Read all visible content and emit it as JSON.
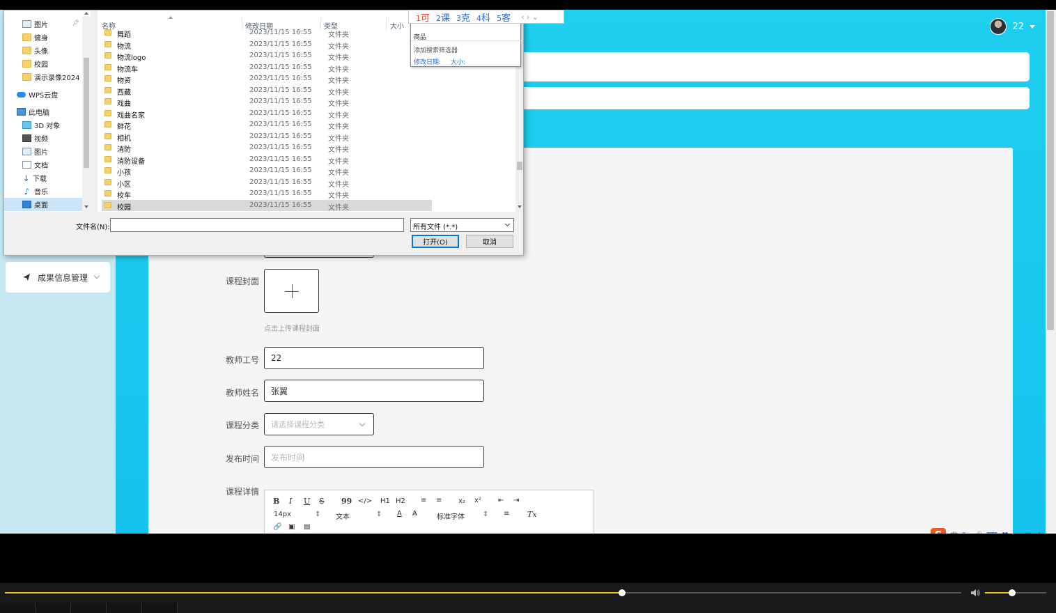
{
  "app": {
    "user_name": "22",
    "menu_item": "成果信息管理",
    "colors": {
      "primary": "#1fcfee",
      "sidebar": "#c6e8f2",
      "panel": "#f5f5f5"
    }
  },
  "form": {
    "cover_label": "课程封面",
    "cover_hint": "点击上传课程封面",
    "teacher_id_label": "教师工号",
    "teacher_id_value": "22",
    "teacher_name_label": "教师姓名",
    "teacher_name_value": "张翼",
    "category_label": "课程分类",
    "category_placeholder": "请选择课程分类",
    "publish_time_label": "发布时间",
    "publish_time_placeholder": "发布时间",
    "detail_label": "课程详情"
  },
  "editor": {
    "bold": "B",
    "italic": "I",
    "underline": "U",
    "strike": "S",
    "quote": "99",
    "code": "</>",
    "h1": "H1",
    "h2": "H2",
    "ordered": "≡",
    "bullet": "≡",
    "sub": "x₂",
    "sup": "x²",
    "indent_out": "⇤",
    "indent_in": "⇥",
    "size": "14px",
    "format": "文本",
    "font_color": "A",
    "bg_color": "A",
    "font_family": "标准字体",
    "align": "≡",
    "clear": "Tx",
    "link": "🔗",
    "image": "▣",
    "video": "▤"
  },
  "dialog": {
    "nav_items": [
      {
        "label": "图片",
        "icon": "image-icon",
        "pinned": true
      },
      {
        "label": "健身",
        "icon": "folder-icon"
      },
      {
        "label": "头像",
        "icon": "folder-icon"
      },
      {
        "label": "校园",
        "icon": "folder-icon"
      },
      {
        "label": "演示录像2024",
        "icon": "folder-icon"
      },
      {
        "label": "WPS云盘",
        "icon": "cloud-icon"
      },
      {
        "label": "此电脑",
        "icon": "computer-icon"
      },
      {
        "label": "3D 对象",
        "icon": "3d-objects-icon"
      },
      {
        "label": "视频",
        "icon": "video-icon"
      },
      {
        "label": "图片",
        "icon": "image-icon"
      },
      {
        "label": "文档",
        "icon": "document-icon"
      },
      {
        "label": "下载",
        "icon": "download-icon"
      },
      {
        "label": "音乐",
        "icon": "music-icon"
      },
      {
        "label": "桌面",
        "icon": "desktop-icon",
        "selected": true
      }
    ],
    "columns": {
      "name": "名称",
      "date": "修改日期",
      "type": "类型",
      "size": "大小"
    },
    "files": [
      {
        "name": "舞蹈",
        "date": "2023/11/15 16:55",
        "type": "文件夹"
      },
      {
        "name": "物流",
        "date": "2023/11/15 16:55",
        "type": "文件夹"
      },
      {
        "name": "物流logo",
        "date": "2023/11/15 16:55",
        "type": "文件夹"
      },
      {
        "name": "物流车",
        "date": "2023/11/15 16:55",
        "type": "文件夹"
      },
      {
        "name": "物资",
        "date": "2023/11/15 16:55",
        "type": "文件夹"
      },
      {
        "name": "西藏",
        "date": "2023/11/15 16:55",
        "type": "文件夹"
      },
      {
        "name": "戏曲",
        "date": "2023/11/15 16:55",
        "type": "文件夹"
      },
      {
        "name": "戏曲名家",
        "date": "2023/11/15 16:55",
        "type": "文件夹"
      },
      {
        "name": "鲜花",
        "date": "2023/11/15 16:55",
        "type": "文件夹"
      },
      {
        "name": "相机",
        "date": "2023/11/15 16:55",
        "type": "文件夹"
      },
      {
        "name": "消防",
        "date": "2023/11/15 16:55",
        "type": "文件夹"
      },
      {
        "name": "消防设备",
        "date": "2023/11/15 16:55",
        "type": "文件夹"
      },
      {
        "name": "小孩",
        "date": "2023/11/15 16:55",
        "type": "文件夹"
      },
      {
        "name": "小区",
        "date": "2023/11/15 16:55",
        "type": "文件夹"
      },
      {
        "name": "校车",
        "date": "2023/11/15 16:55",
        "type": "文件夹"
      },
      {
        "name": "校园",
        "date": "2023/11/15 16:55",
        "type": "文件夹",
        "selected": true
      }
    ],
    "filename_label": "文件名(N):",
    "filename_value": "",
    "filter_value": "所有文件 (*.*)",
    "open_label": "打开(O)",
    "cancel_label": "取消",
    "search": {
      "recent": "商品",
      "add_filter": "添加搜索筛选器",
      "filter_date": "修改日期:",
      "filter_size": "大小:"
    }
  },
  "ime": {
    "candidates": [
      {
        "num": "1",
        "text": "可"
      },
      {
        "num": "2",
        "text": "课"
      },
      {
        "num": "3",
        "text": "克"
      },
      {
        "num": "4",
        "text": "科"
      },
      {
        "num": "5",
        "text": "客"
      }
    ],
    "nav": "‹ › ⌄",
    "status_logo": "S",
    "status_mode": "中",
    "status_punct": "°,"
  },
  "player": {
    "progress": 0.645,
    "volume": 0.44,
    "accent": "#e6c619"
  }
}
